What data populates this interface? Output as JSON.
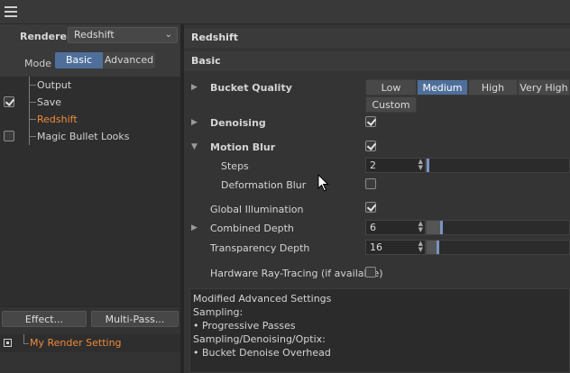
{
  "topbar": {
    "menu_icon": "hamburger-menu-icon"
  },
  "left": {
    "renderer_label": "Renderer",
    "renderer_value": "Redshift",
    "mode_label": "Mode",
    "mode_options": [
      "Basic",
      "Advanced"
    ],
    "mode_selected": "Basic",
    "tree": [
      {
        "label": "Output",
        "checkbox": "none",
        "active": false
      },
      {
        "label": "Save",
        "checkbox": "checked",
        "active": false
      },
      {
        "label": "Redshift",
        "checkbox": "none",
        "active": true
      },
      {
        "label": "Magic Bullet Looks",
        "checkbox": "unchecked",
        "active": false
      }
    ],
    "effect_button": "Effect...",
    "multipass_button": "Multi-Pass...",
    "render_setting": "My Render Setting"
  },
  "right": {
    "header": "Redshift",
    "subheader": "Basic",
    "bucket_quality_label": "Bucket Quality",
    "bucket_quality_options": [
      "Low",
      "Medium",
      "High",
      "Very High",
      "Custom"
    ],
    "bucket_quality_selected": "Medium",
    "denoising_label": "Denoising",
    "denoising_checked": true,
    "motion_blur_label": "Motion Blur",
    "motion_blur_checked": true,
    "steps_label": "Steps",
    "steps_value": "2",
    "deformation_blur_label": "Deformation Blur",
    "deformation_blur_checked": false,
    "global_illumination_label": "Global Illumination",
    "global_illumination_checked": true,
    "combined_depth_label": "Combined Depth",
    "combined_depth_value": "6",
    "transparency_depth_label": "Transparency Depth",
    "transparency_depth_value": "16",
    "hw_raytracing_label": "Hardware Ray-Tracing (if available)",
    "hw_raytracing_checked": false,
    "info_lines": [
      "Modified Advanced Settings",
      "Sampling:",
      "• Progressive Passes",
      "Sampling/Denoising/Optix:",
      "• Bucket Denoise Overhead"
    ]
  },
  "colors": {
    "accent": "#4f6f9b",
    "active_text": "#f08a3a",
    "panel_bg": "#343434"
  }
}
